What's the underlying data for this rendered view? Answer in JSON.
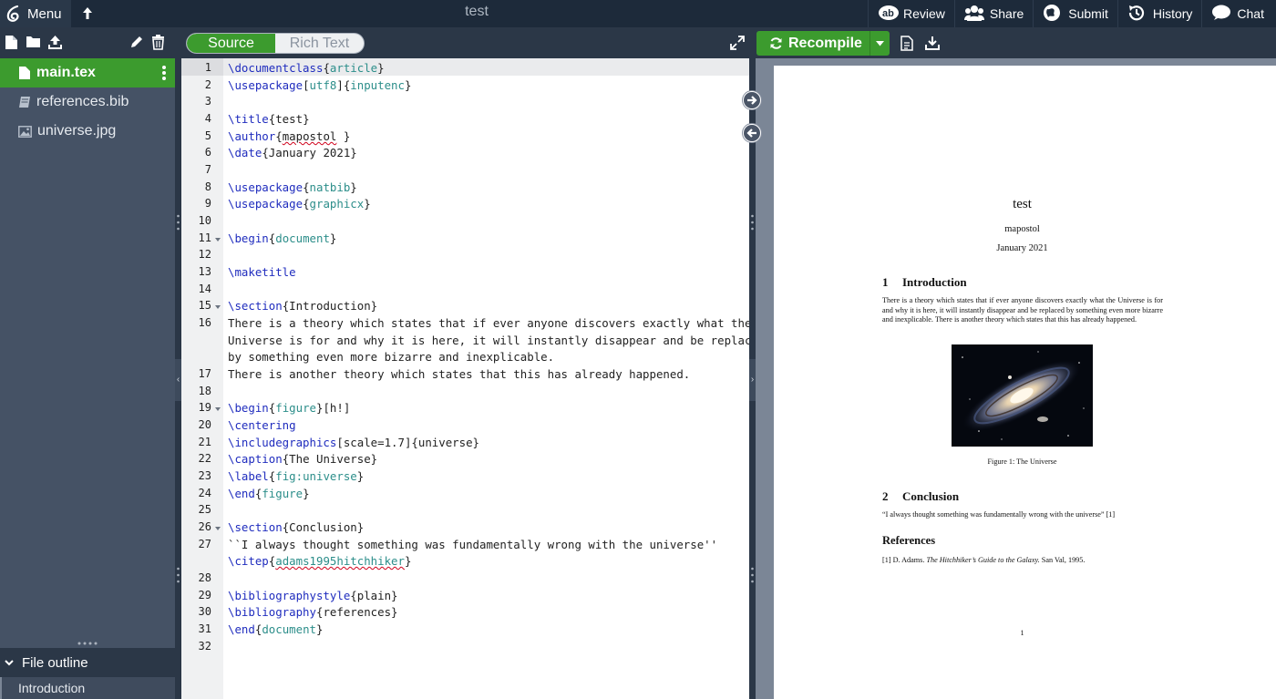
{
  "topbar": {
    "menu_label": "Menu",
    "project_title": "test",
    "buttons": [
      {
        "label": "Review",
        "icon": "review-icon"
      },
      {
        "label": "Share",
        "icon": "share-icon"
      },
      {
        "label": "Submit",
        "icon": "submit-icon"
      },
      {
        "label": "History",
        "icon": "history-icon"
      },
      {
        "label": "Chat",
        "icon": "chat-icon"
      }
    ]
  },
  "file_tree": {
    "files": [
      {
        "name": "main.tex",
        "icon": "file-icon",
        "active": true
      },
      {
        "name": "references.bib",
        "icon": "book-icon",
        "active": false
      },
      {
        "name": "universe.jpg",
        "icon": "image-icon",
        "active": false
      }
    ]
  },
  "outline": {
    "header": "File outline",
    "items": [
      "Introduction"
    ]
  },
  "editor": {
    "mode_source": "Source",
    "mode_rich": "Rich Text"
  },
  "code": {
    "line_numbers": [
      "1",
      "2",
      "3",
      "4",
      "5",
      "6",
      "7",
      "8",
      "9",
      "10",
      "11",
      "12",
      "13",
      "14",
      "15",
      "16",
      "17",
      "18",
      "19",
      "20",
      "21",
      "22",
      "23",
      "24",
      "25",
      "26",
      "27",
      "28",
      "29",
      "30",
      "31",
      "32"
    ],
    "l1": {
      "cmd": "\\documentclass",
      "open": "{",
      "arg": "article",
      "close": "}"
    },
    "l2": {
      "cmd": "\\usepackage",
      "open": "[",
      "arg": "utf8",
      "mid": "]{",
      "arg2": "inputenc",
      "close": "}"
    },
    "l4": {
      "cmd": "\\title",
      "rest": "{test}"
    },
    "l5": {
      "cmd": "\\author",
      "open": "{",
      "word": "mapostol",
      "close": " }"
    },
    "l6": {
      "cmd": "\\date",
      "rest": "{January 2021}"
    },
    "l8": {
      "cmd": "\\usepackage",
      "open": "{",
      "arg": "natbib",
      "close": "}"
    },
    "l9": {
      "cmd": "\\usepackage",
      "open": "{",
      "arg": "graphicx",
      "close": "}"
    },
    "l11": {
      "cmd": "\\begin",
      "open": "{",
      "arg": "document",
      "close": "}"
    },
    "l13": {
      "cmd": "\\maketitle"
    },
    "l15": {
      "cmd": "\\section",
      "rest": "{Introduction}"
    },
    "l16a": "There is a theory which states that if ever anyone discovers exactly what the",
    "l16b": "Universe is for and why it is here, it will instantly disappear and be replaced",
    "l16c": "by something even more bizarre and inexplicable.",
    "l17": "There is another theory which states that this has already happened.",
    "l19": {
      "cmd": "\\begin",
      "open": "{",
      "arg": "figure",
      "close": "}[h!]"
    },
    "l20": {
      "cmd": "\\centering"
    },
    "l21": {
      "cmd": "\\includegraphics",
      "rest": "[scale=1.7]{universe}"
    },
    "l22": {
      "cmd": "\\caption",
      "rest": "{The Universe}"
    },
    "l23": {
      "cmd": "\\label",
      "open": "{",
      "arg": "fig:universe",
      "close": "}"
    },
    "l24": {
      "cmd": "\\end",
      "open": "{",
      "arg": "figure",
      "close": "}"
    },
    "l26": {
      "cmd": "\\section",
      "rest": "{Conclusion}"
    },
    "l27a": "``I always thought something was fundamentally wrong with the universe''",
    "l27b": {
      "cmd": "\\citep",
      "open": "{",
      "arg": "adams1995hitchhiker",
      "close": "}"
    },
    "l29": {
      "cmd": "\\bibliographystyle",
      "rest": "{plain}"
    },
    "l30": {
      "cmd": "\\bibliography",
      "rest": "{references}"
    },
    "l31": {
      "cmd": "\\end",
      "open": "{",
      "arg": "document",
      "close": "}"
    }
  },
  "pdf": {
    "recompile_label": "Recompile",
    "title": "test",
    "author": "mapostol",
    "date": "January 2021",
    "sec1_num": "1",
    "sec1_title": "Introduction",
    "body": "There is a theory which states that if ever anyone discovers exactly what the Universe is for and why it is here, it will instantly disappear and be replaced by something even more bizarre and inexplicable. There is another theory which states that this has already happened.",
    "caption": "Figure 1: The Universe",
    "sec2_num": "2",
    "sec2_title": "Conclusion",
    "conclusion": "“I always thought something was fundamentally wrong with the universe” [1]",
    "refs_title": "References",
    "ref_num": "[1]",
    "ref_author": "D. Adams.",
    "ref_book": "The Hitchhiker’s Guide to the Galaxy.",
    "ref_pub": "San Val, 1995.",
    "page_number": "1"
  },
  "colors": {
    "accent_green": "#3c9b2e",
    "topbar_bg": "#1d2a3a",
    "panel_bg": "#455265",
    "latex_command": "#1f2cbe",
    "latex_argument": "#2c8e8a"
  }
}
